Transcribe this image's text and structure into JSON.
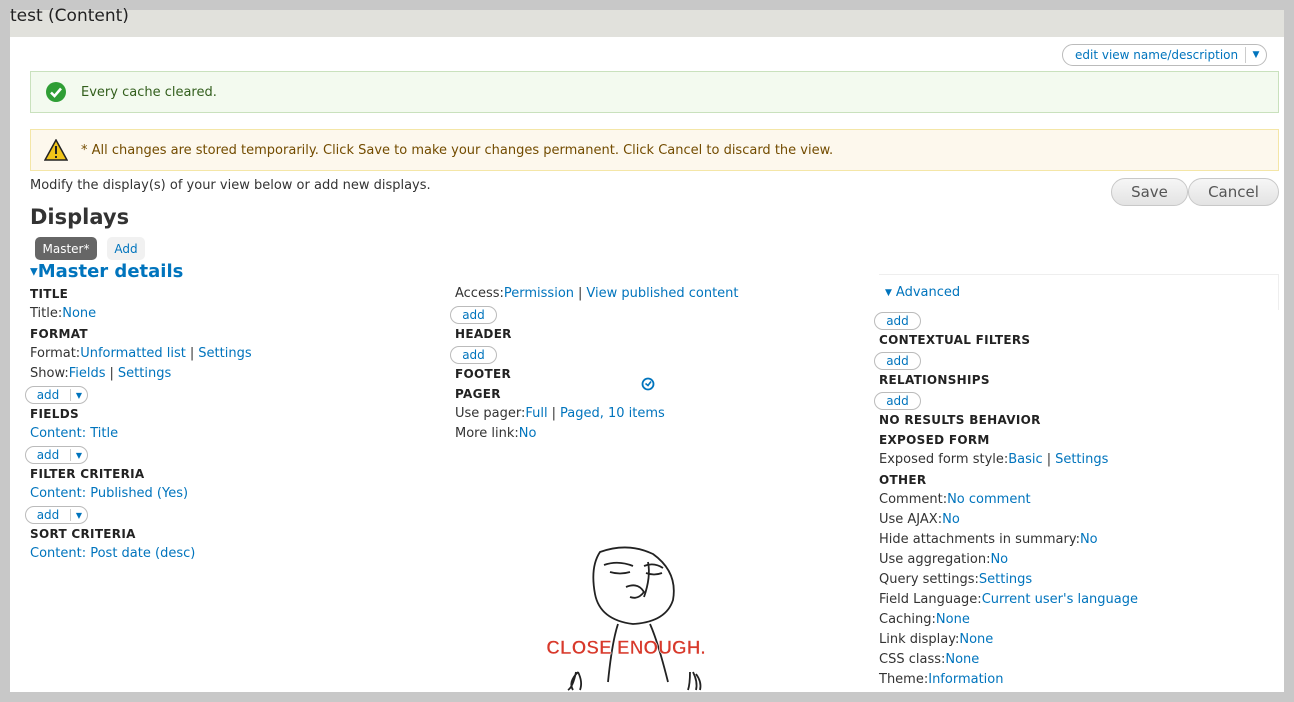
{
  "window": {
    "title": "test (Content)"
  },
  "toolbar": {
    "edit_view_label": "edit view name/description"
  },
  "messages": {
    "status": "Every cache cleared.",
    "warning": "* All changes are stored temporarily. Click Save to make your changes permanent. Click Cancel to discard the view."
  },
  "intro": "Modify the display(s) of your view below or add new displays.",
  "actions": {
    "save": "Save",
    "cancel": "Cancel"
  },
  "displays": {
    "heading": "Displays",
    "tabs": [
      {
        "label": "Master*",
        "active": true
      }
    ],
    "add_label": "Add",
    "details_heading": "Master details"
  },
  "col1": {
    "title_h": "TITLE",
    "title_label": "Title:",
    "title_value": "None",
    "format_h": "FORMAT",
    "format_label": "Format:",
    "format_value": "Unformatted list",
    "format_settings": "Settings",
    "show_label": "Show:",
    "show_value": "Fields",
    "show_settings": "Settings",
    "add_label": "add",
    "fields_h": "FIELDS",
    "fields_item": "Content: Title",
    "filter_h": "FILTER CRITERIA",
    "filter_item": "Content: Published (Yes)",
    "sort_h": "SORT CRITERIA",
    "sort_item": "Content: Post date (desc)"
  },
  "col2": {
    "access_label": "Access:",
    "access_value": "Permission",
    "access_settings": "View published content",
    "add_label": "add",
    "header_h": "HEADER",
    "footer_h": "FOOTER",
    "pager_h": "PAGER",
    "pager_label": "Use pager:",
    "pager_value": "Full",
    "pager_settings": "Paged, 10 items",
    "more_label": "More link:",
    "more_value": "No"
  },
  "col3": {
    "advanced_label": "Advanced",
    "add_label": "add",
    "contextual_h": "CONTEXTUAL FILTERS",
    "relationships_h": "RELATIONSHIPS",
    "noresults_h": "NO RESULTS BEHAVIOR",
    "exposed_h": "EXPOSED FORM",
    "exposed_label": "Exposed form style:",
    "exposed_value": "Basic",
    "exposed_settings": "Settings",
    "other_h": "OTHER",
    "other": [
      {
        "label": "Comment:",
        "value": "No comment"
      },
      {
        "label": "Use AJAX:",
        "value": "No"
      },
      {
        "label": "Hide attachments in summary:",
        "value": "No"
      },
      {
        "label": "Use aggregation:",
        "value": "No"
      },
      {
        "label": "Query settings:",
        "value": "Settings"
      },
      {
        "label": "Field Language:",
        "value": "Current user's language"
      },
      {
        "label": "Caching:",
        "value": "None"
      },
      {
        "label": "Link display:",
        "value": "None"
      },
      {
        "label": "CSS class:",
        "value": "None"
      },
      {
        "label": "Theme:",
        "value": "Information"
      }
    ]
  },
  "meme": {
    "caption": "CLOSE ENOUGH."
  },
  "colors": {
    "link": "#0074bd",
    "status_bg": "#f3faef",
    "warning_bg": "#fdf8ed",
    "meme_text": "#d8392b"
  }
}
